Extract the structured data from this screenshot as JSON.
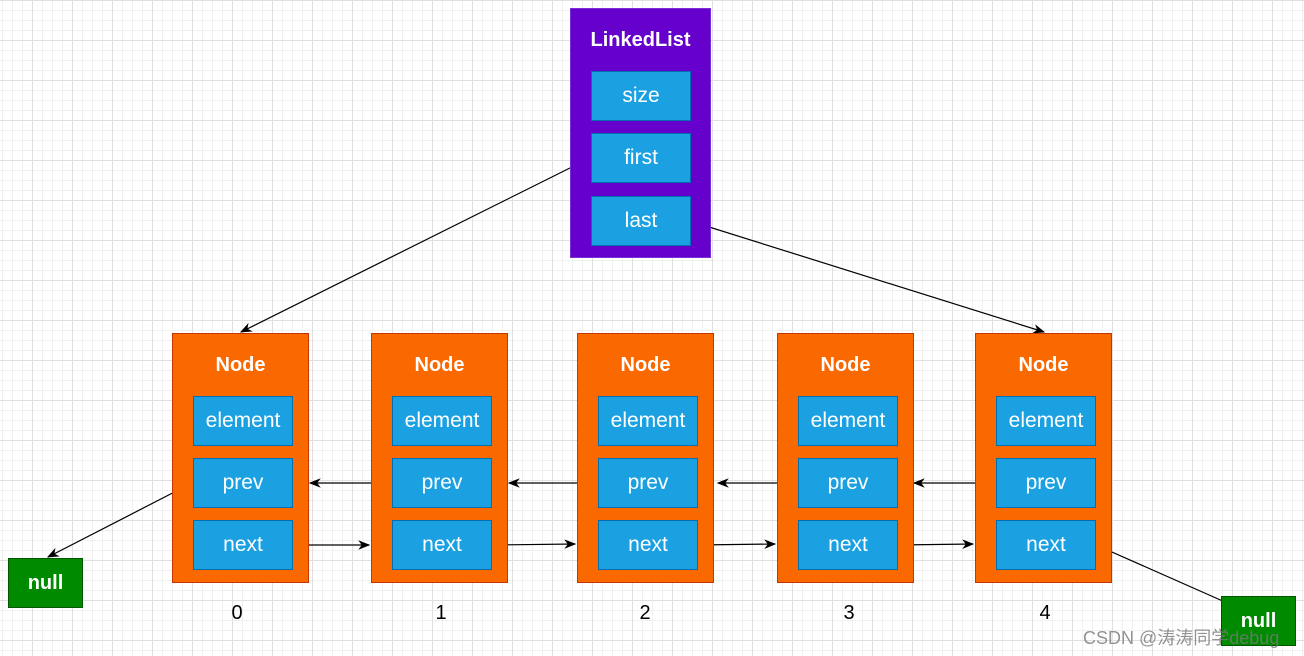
{
  "linked_list": {
    "title": "LinkedList",
    "fields": [
      "size",
      "first",
      "last"
    ]
  },
  "nodes": [
    {
      "title": "Node",
      "fields": [
        "element",
        "prev",
        "next"
      ],
      "index": "0"
    },
    {
      "title": "Node",
      "fields": [
        "element",
        "prev",
        "next"
      ],
      "index": "1"
    },
    {
      "title": "Node",
      "fields": [
        "element",
        "prev",
        "next"
      ],
      "index": "2"
    },
    {
      "title": "Node",
      "fields": [
        "element",
        "prev",
        "next"
      ],
      "index": "3"
    },
    {
      "title": "Node",
      "fields": [
        "element",
        "prev",
        "next"
      ],
      "index": "4"
    }
  ],
  "null_left": "null",
  "null_right": "null",
  "watermark": "CSDN @涛涛同学debug",
  "colors": {
    "list": "#6600cc",
    "node": "#fa6800",
    "field": "#1ba1e2",
    "null": "#008a00"
  }
}
